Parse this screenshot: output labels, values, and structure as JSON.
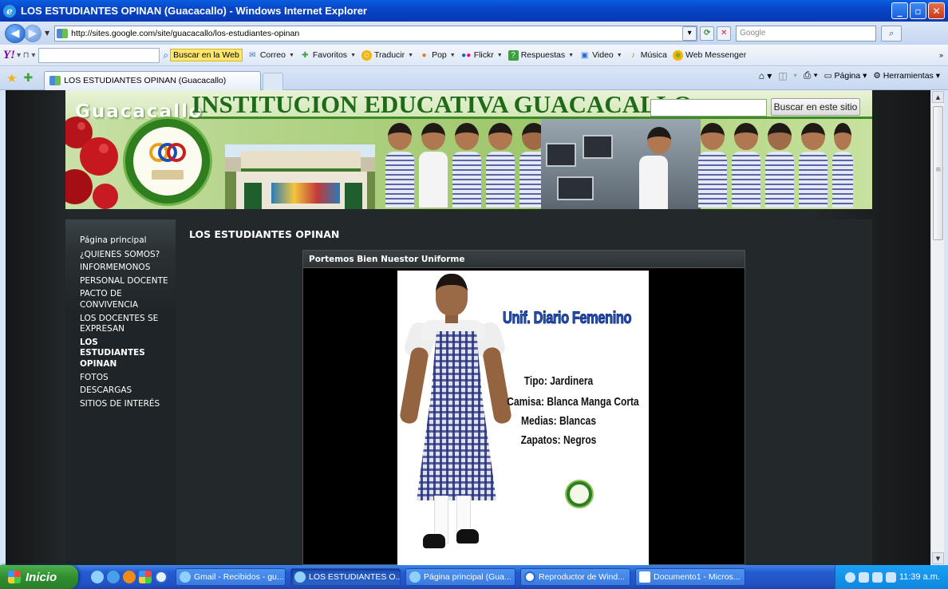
{
  "window": {
    "title": "LOS ESTUDIANTES OPINAN (Guacacallo) - Windows Internet Explorer",
    "min_label": "_",
    "max_label": "▫",
    "close_label": "✕"
  },
  "address": {
    "url": "http://sites.google.com/site/guacacallo/los-estudiantes-opinan",
    "search_placeholder": "Google"
  },
  "yahoo_toolbar": {
    "logo": "Y!",
    "search_button": "Buscar en la Web",
    "items": [
      {
        "label": "Correo",
        "icon": "mail-icon"
      },
      {
        "label": "Favoritos",
        "icon": "favorites-icon"
      },
      {
        "label": "Traducir",
        "icon": "translate-icon"
      },
      {
        "label": "Pop",
        "icon": "pop-icon"
      },
      {
        "label": "Flickr",
        "icon": "flickr-icon"
      },
      {
        "label": "Respuestas",
        "icon": "answers-icon"
      },
      {
        "label": "Video",
        "icon": "video-icon"
      },
      {
        "label": "Música",
        "icon": "music-icon"
      },
      {
        "label": "Web Messenger",
        "icon": "messenger-icon"
      }
    ]
  },
  "tabs": {
    "active_tab": "LOS ESTUDIANTES OPINAN (Guacacallo)",
    "page_menu": "Página",
    "tools_menu": "Herramientas"
  },
  "site": {
    "name": "Guacacallo",
    "title": "INSTITUCION EDUCATIVA GUACACALLO",
    "search_button": "Buscar en este sitio",
    "nav": [
      "Página principal",
      "¿QUIENES SOMOS?",
      "INFORMEMONOS",
      "PERSONAL DOCENTE",
      "PACTO DE CONVIVENCIA",
      "LOS DOCENTES SE EXPRESAN",
      "LOS ESTUDIANTES OPINAN",
      "FOTOS",
      "DESCARGAS",
      "SITIOS DE INTERÉS"
    ],
    "page_title": "LOS ESTUDIANTES OPINAN",
    "gadget_title": "Portemos Bien Nuestor Uniforme",
    "poster": {
      "heading": "Unif. Diario Femenino",
      "lines": [
        "Tipo:  Jardinera",
        "Camisa:  Blanca Manga Corta",
        "Medias:  Blancas",
        "Zapatos:  Negros"
      ]
    }
  },
  "taskbar": {
    "start": "Inicio",
    "tasks": [
      "Gmail - Recibidos - gu...",
      "LOS ESTUDIANTES O...",
      "Página principal (Gua...",
      "Reproductor de Wind...",
      "Documento1 - Micros..."
    ],
    "clock": "11:39 a.m."
  }
}
